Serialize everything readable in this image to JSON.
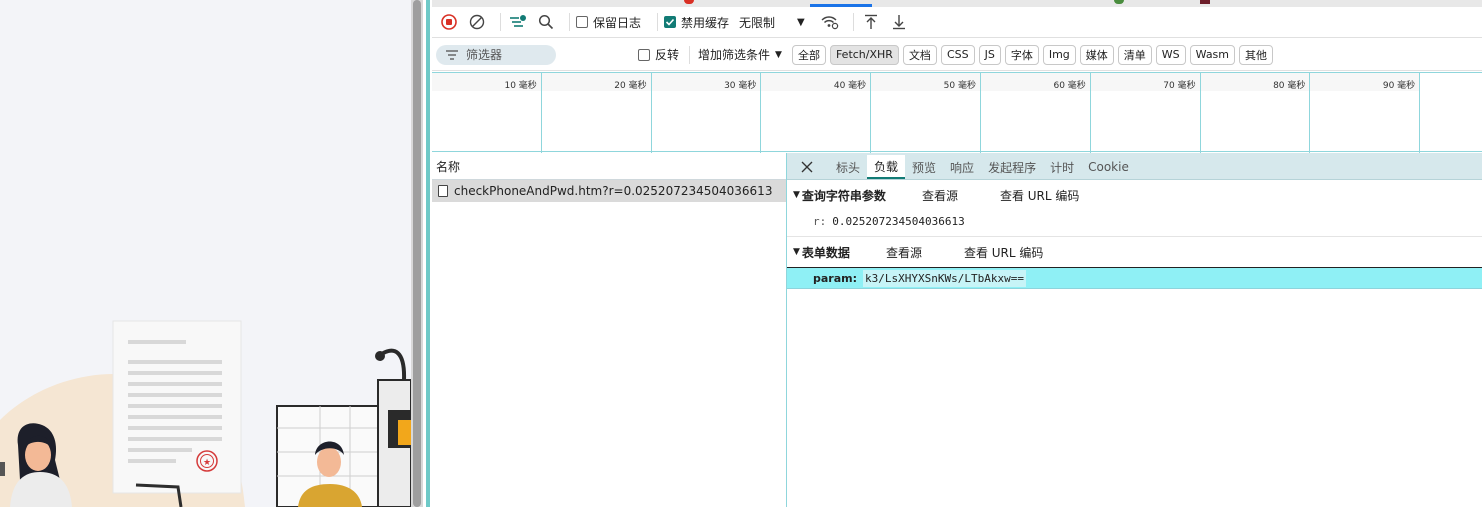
{
  "toolbar": {
    "preserve_log": "保留日志",
    "disable_cache": "禁用缓存",
    "throttling": "无限制"
  },
  "filterbar": {
    "filter_placeholder": "筛选器",
    "invert": "反转",
    "more_filters": "增加筛选条件",
    "types": [
      "全部",
      "Fetch/XHR",
      "文档",
      "CSS",
      "JS",
      "字体",
      "Img",
      "媒体",
      "清单",
      "WS",
      "Wasm",
      "其他"
    ],
    "active_type": "Fetch/XHR"
  },
  "timeline": {
    "ticks": [
      "10 毫秒",
      "20 毫秒",
      "30 毫秒",
      "40 毫秒",
      "50 毫秒",
      "60 毫秒",
      "70 毫秒",
      "80 毫秒",
      "90 毫秒"
    ]
  },
  "request_list": {
    "header": "名称",
    "rows": [
      {
        "name": "checkPhoneAndPwd.htm?r=0.025207234504036613"
      }
    ]
  },
  "detail": {
    "tabs": [
      "标头",
      "负载",
      "预览",
      "响应",
      "发起程序",
      "计时",
      "Cookie"
    ],
    "active_tab": "负载",
    "query_section": {
      "title": "查询字符串参数",
      "view_source": "查看源",
      "view_url_encoded": "查看 URL 编码",
      "params": [
        {
          "key": "r:",
          "value": "0.025207234504036613"
        }
      ]
    },
    "form_section": {
      "title": "表单数据",
      "view_source": "查看源",
      "view_url_encoded": "查看 URL 编码",
      "params": [
        {
          "key": "param:",
          "value": "k3/LsXHYXSnKWs/LTbAkxw=="
        }
      ]
    }
  },
  "colors": {
    "accent": "#127b75",
    "record_red": "#d93025",
    "highlight_row": "#8ff0f5",
    "panel_tab_bg": "#d6e8ec"
  }
}
